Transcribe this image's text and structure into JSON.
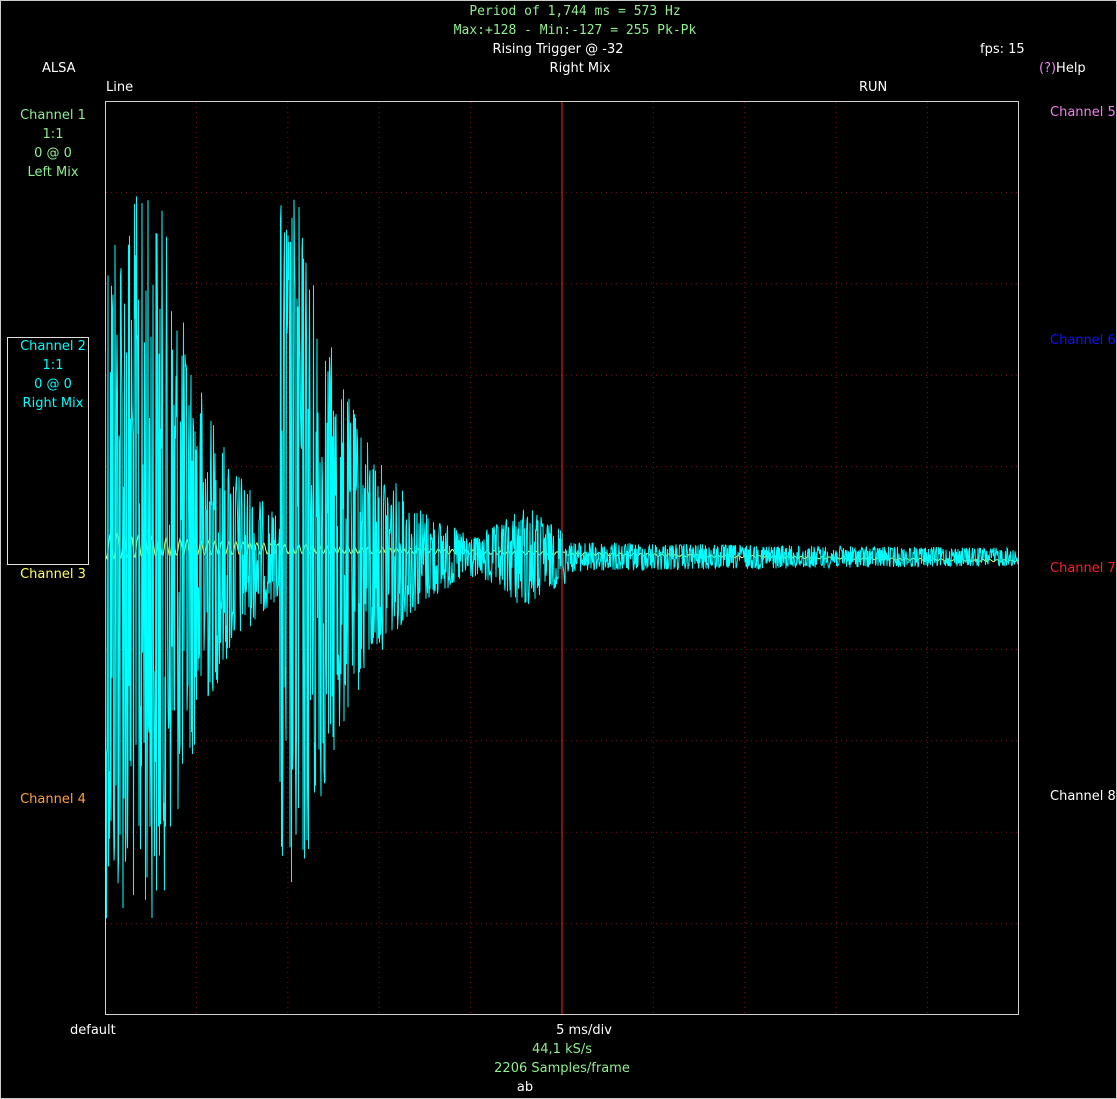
{
  "colors": {
    "green": "#90ee90",
    "cyan": "#00ffff",
    "yellow": "#ffff60",
    "orange": "#ffa040",
    "magenta": "#ee82ee",
    "blue": "#1010ff",
    "red": "#ff2020",
    "white": "#ffffff"
  },
  "header": {
    "period": "Period of 1,744 ms =   573 Hz",
    "maxmin": "Max:+128 - Min:-127 = 255 Pk-Pk",
    "trigger": "Rising Trigger @ -32",
    "source": "Right Mix",
    "fps": "fps: 15",
    "backend": "ALSA",
    "help_prefix": "(?)",
    "help": "Help",
    "line": "Line",
    "run": "RUN"
  },
  "left_channels": {
    "ch1": {
      "name": "Channel 1",
      "scale": "1:1",
      "offset": "0 @ 0",
      "source": "Left Mix"
    },
    "ch2": {
      "name": "Channel 2",
      "scale": "1:1",
      "offset": "0 @ 0",
      "source": "Right Mix"
    },
    "ch3": {
      "name": "Channel 3"
    },
    "ch4": {
      "name": "Channel 4"
    }
  },
  "right_channels": {
    "ch5": "Channel 5",
    "ch6": "Channel 6",
    "ch7": "Channel 7",
    "ch8": "Channel 8"
  },
  "footer": {
    "device": "default",
    "timebase": "5 ms/div",
    "rate": "44,1 kS/s",
    "samples": "2206 Samples/frame",
    "mode": "ab"
  }
}
